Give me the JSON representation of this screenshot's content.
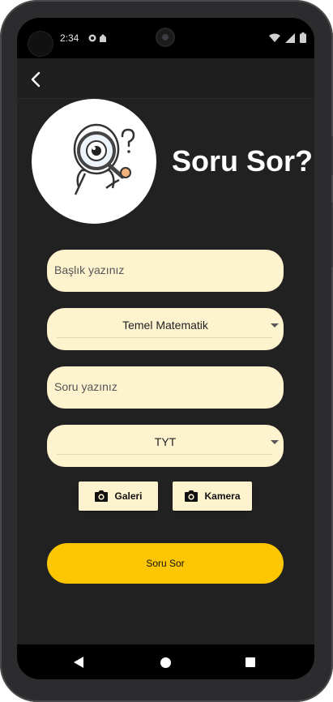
{
  "status_bar": {
    "time": "2:34"
  },
  "app_bar": {
    "back_icon": "chevron-left-icon"
  },
  "header": {
    "title": "Soru Sor?",
    "logo_icon": "magnifier-question-illustration"
  },
  "form": {
    "title_field": {
      "placeholder": "Başlık yazınız"
    },
    "subject_dropdown": {
      "selected": "Temel Matematik"
    },
    "question_field": {
      "placeholder": "Soru yazınız"
    },
    "exam_dropdown": {
      "selected": "TYT"
    }
  },
  "buttons": {
    "gallery_label": "Galeri",
    "camera_label": "Kamera",
    "submit_label": "Soru Sor"
  },
  "colors": {
    "background": "#212121",
    "field": "#fdf3cf",
    "accent": "#fcc603"
  }
}
